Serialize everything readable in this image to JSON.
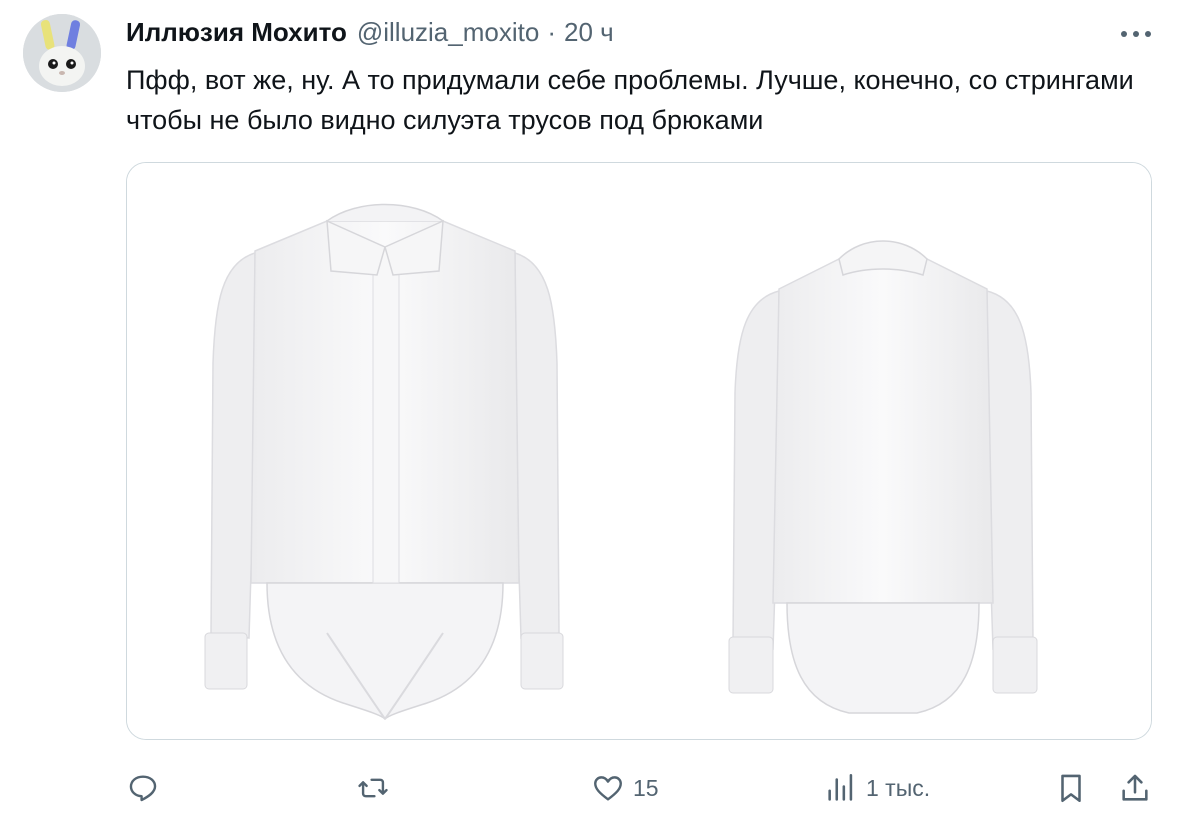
{
  "tweet": {
    "author": {
      "display_name": "Иллюзия Мохито",
      "handle": "@illuzia_moxito",
      "avatar_icon": "bunny-avatar"
    },
    "separator": "·",
    "time": "20 ч",
    "text": "Пфф, вот же, ну. А то придумали себе проблемы. Лучше, конечно, со стрингами чтобы не было видно силуэта трусов под брюками",
    "media": {
      "description_icons": [
        "white-shirt-bodysuit-front",
        "white-shirt-bodysuit-back"
      ]
    },
    "actions": {
      "reply_count": "",
      "retweet_count": "",
      "like_count": "15",
      "views_count": "1 тыс."
    }
  },
  "colors": {
    "text_primary": "#0f1419",
    "text_secondary": "#536471",
    "border": "#cfd9de"
  }
}
